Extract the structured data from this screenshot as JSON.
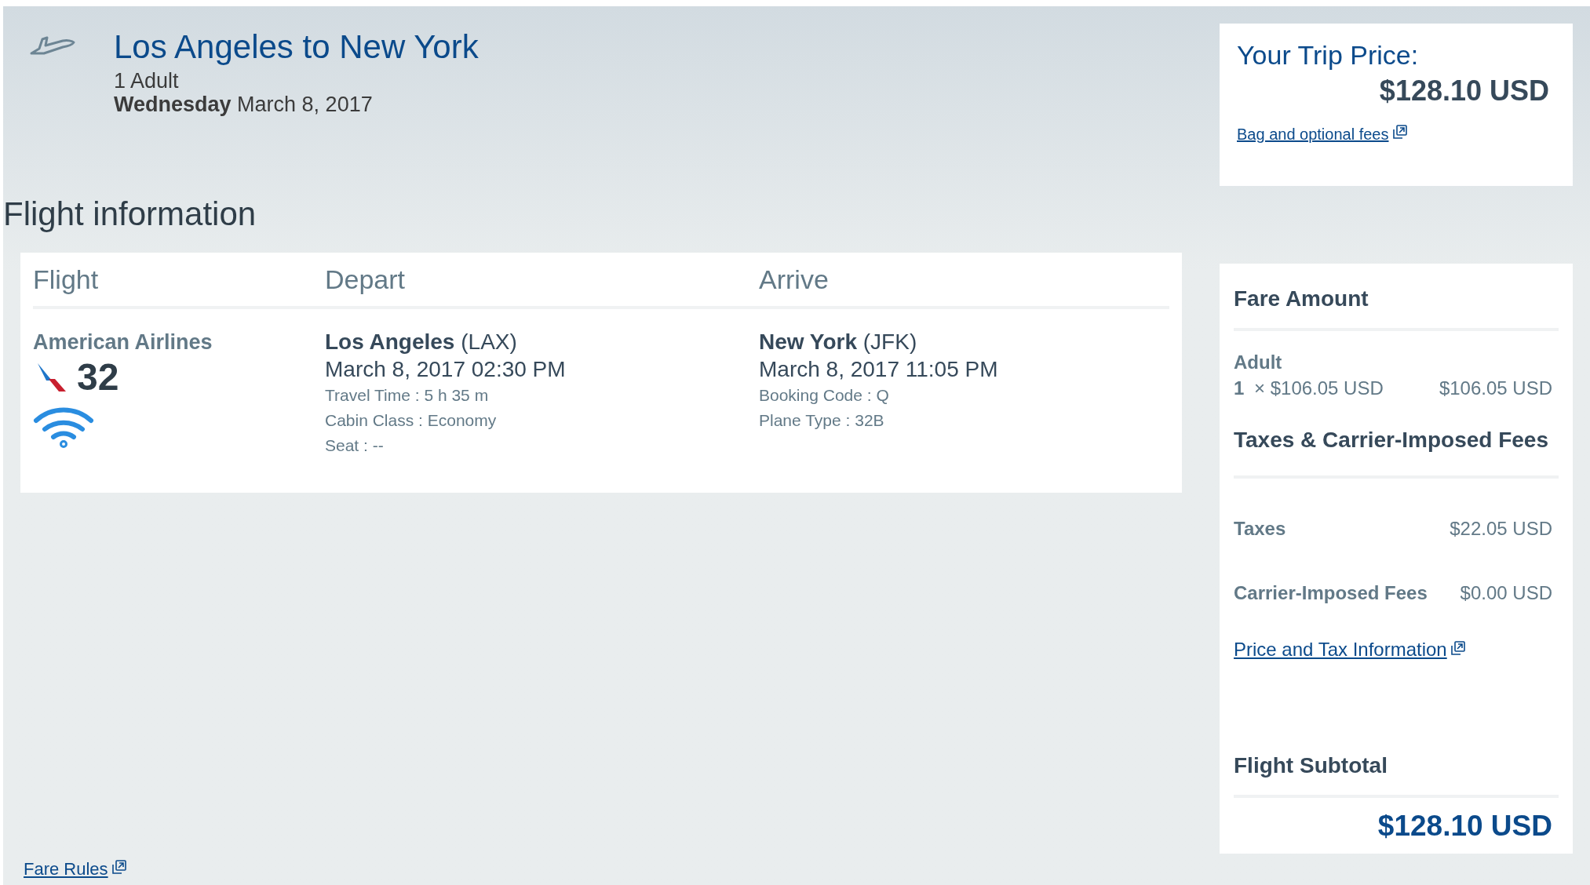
{
  "header": {
    "title": "Los Angeles to New York",
    "passengers": "1 Adult",
    "day": "Wednesday",
    "date": "March 8, 2017"
  },
  "section_title": "Flight information",
  "flight_table": {
    "columns": [
      "Flight",
      "Depart",
      "Arrive"
    ],
    "airline": "American Airlines",
    "flight_number": "32",
    "depart": {
      "city": "Los Angeles",
      "code": "(LAX)",
      "datetime": "March 8, 2017 02:30 PM",
      "details": [
        "Travel Time : 5 h 35 m",
        "Cabin Class : Economy",
        "Seat : --"
      ]
    },
    "arrive": {
      "city": "New York",
      "code": "(JFK)",
      "datetime": "March 8, 2017 11:05 PM",
      "details": [
        "Booking Code : Q",
        "Plane Type : 32B"
      ]
    }
  },
  "trip_price": {
    "label": "Your Trip Price:",
    "amount": "$128.10 USD",
    "link": "Bag and optional fees"
  },
  "fare_summary": {
    "fare_heading": "Fare Amount",
    "passenger_type": "Adult",
    "quantity": "1",
    "unit_price": "× $106.05 USD",
    "fare_total": "$106.05 USD",
    "taxes_heading": "Taxes & Carrier-Imposed Fees",
    "rows": [
      {
        "label": "Taxes",
        "value": "$22.05 USD"
      },
      {
        "label": "Carrier-Imposed Fees",
        "value": "$0.00 USD"
      }
    ],
    "link": "Price and Tax Information",
    "subtotal_label": "Flight Subtotal",
    "subtotal": "$128.10 USD"
  },
  "footer_link": "Fare Rules"
}
